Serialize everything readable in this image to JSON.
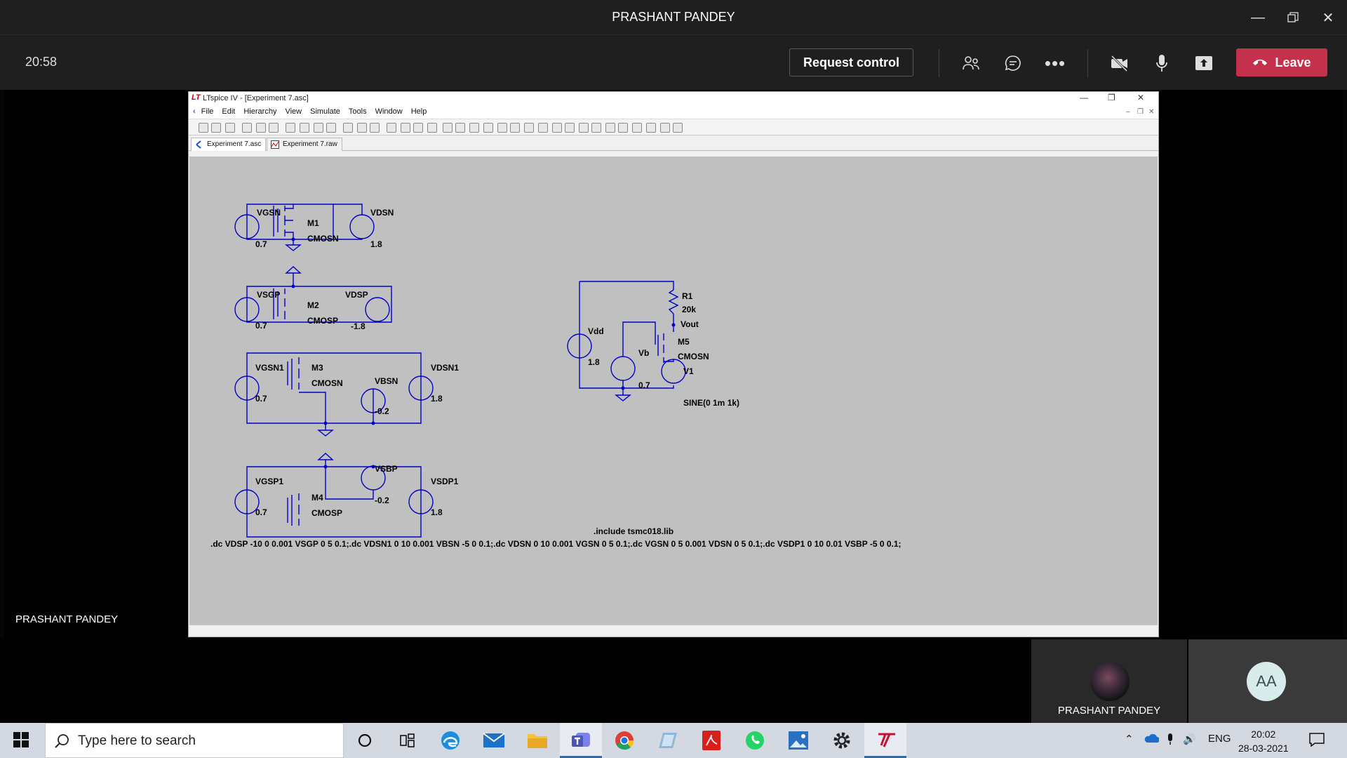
{
  "teams": {
    "window_title": "PRASHANT PANDEY",
    "timer": "20:58",
    "request_control_label": "Request control",
    "leave_label": "Leave",
    "presenter_name": "PRASHANT PANDEY",
    "participants": [
      {
        "name": "PRASHANT PANDEY",
        "avatar": "photo"
      },
      {
        "name": "",
        "initials": "AA"
      }
    ],
    "colors": {
      "leave": "#c4314b",
      "bar": "#1f1f1f"
    }
  },
  "ltspice": {
    "window_title": "LTspice IV - [Experiment 7.asc]",
    "logo_text": "LT",
    "menu": [
      "File",
      "Edit",
      "Hierarchy",
      "View",
      "Simulate",
      "Tools",
      "Window",
      "Help"
    ],
    "tabs": [
      {
        "label": "Experiment 7.asc",
        "active": true
      },
      {
        "label": "Experiment 7.raw",
        "active": false
      }
    ],
    "schematic_labels": {
      "vgsn": "VGSN",
      "vgsn_val": "0.7",
      "m1": "M1",
      "m1_model": "CMOSN",
      "vdsn": "VDSN",
      "vdsn_val": "1.8",
      "vsgp": "VSGP",
      "vsgp_val": "0.7",
      "m2": "M2",
      "m2_model": "CMOSP",
      "vdsp": "VDSP",
      "vdsp_val": "-1.8",
      "vgsn1": "VGSN1",
      "vgsn1_val": "0.7",
      "m3": "M3",
      "m3_model": "CMOSN",
      "vbsn": "VBSN",
      "vbsn_val": "-0.2",
      "vdsn1": "VDSN1",
      "vdsn1_val": "1.8",
      "vgsp1": "VGSP1",
      "vgsp1_val": "0.7",
      "vsbp": "VSBP",
      "vsbp_val": "-0.2",
      "m4": "M4",
      "m4_model": "CMOSP",
      "vsdp1": "VSDP1",
      "vsdp1_val": "1.8",
      "r1": "R1",
      "r1_val": "20k",
      "vout": "Vout",
      "vdd": "Vdd",
      "vdd_val": "1.8",
      "vb": "Vb",
      "vb_val": "0.7",
      "m5": "M5",
      "m5_model": "CMOSN",
      "v1": "V1",
      "v1_val": "SINE(0 1m 1k)"
    },
    "directive_include": ".include tsmc018.lib",
    "directive_dc": ".dc VDSP -10 0 0.001 VSGP 0 5 0.1;.dc VDSN1 0 10 0.001 VBSN -5 0 0.1;.dc VDSN 0 10 0.001 VGSN 0 5 0.1;.dc VGSN 0 5 0.001 VDSN 0 5 0.1;.dc VSDP1 0 10 0.01 VSBP -5 0 0.1;",
    "colors": {
      "wire": "#0000c8",
      "canvas": "#c0c0c0"
    }
  },
  "taskbar": {
    "search_placeholder": "Type here to search",
    "language": "ENG",
    "time": "20:02",
    "date": "28-03-2021"
  }
}
